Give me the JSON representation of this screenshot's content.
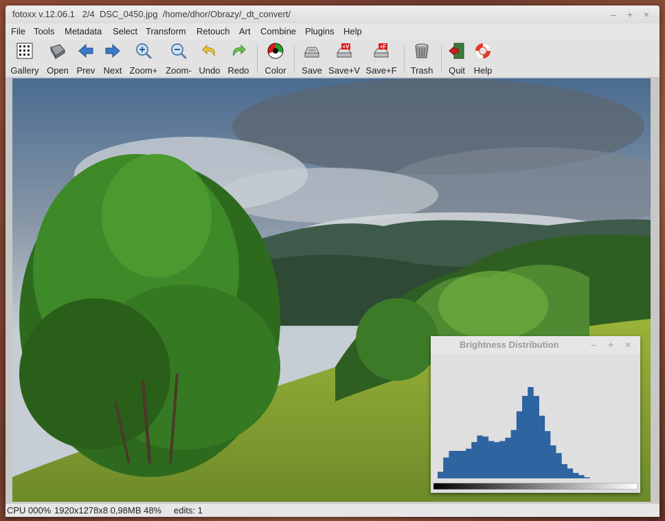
{
  "window": {
    "title": "fotoxx v.12.06.1   2/4  DSC_0450.jpg  /home/dhor/Obrazy/_dt_convert/",
    "controls": {
      "minimize": "–",
      "maximize": "+",
      "close": "×"
    }
  },
  "menu": [
    "File",
    "Tools",
    "Metadata",
    "Select",
    "Transform",
    "Retouch",
    "Art",
    "Combine",
    "Plugins",
    "Help"
  ],
  "toolbar": [
    {
      "label": "Gallery",
      "icon": "gallery-icon"
    },
    {
      "label": "Open",
      "icon": "open-icon"
    },
    {
      "label": "Prev",
      "icon": "prev-arrow-icon"
    },
    {
      "label": "Next",
      "icon": "next-arrow-icon"
    },
    {
      "label": "Zoom+",
      "icon": "zoom-in-icon"
    },
    {
      "label": "Zoom-",
      "icon": "zoom-out-icon"
    },
    {
      "label": "Undo",
      "icon": "undo-icon"
    },
    {
      "label": "Redo",
      "icon": "redo-icon"
    },
    {
      "label": "Color",
      "icon": "color-wheel-icon"
    },
    {
      "label": "Save",
      "icon": "save-icon"
    },
    {
      "label": "Save+V",
      "icon": "save-version-icon"
    },
    {
      "label": "Save+F",
      "icon": "save-file-icon"
    },
    {
      "label": "Trash",
      "icon": "trash-icon"
    },
    {
      "label": "Quit",
      "icon": "quit-icon"
    },
    {
      "label": "Help",
      "icon": "lifebuoy-icon"
    }
  ],
  "status": {
    "cpu": "CPU 000%",
    "info": "1920x1278x8 0,98MB 48%",
    "edits": "edits: 1"
  },
  "histogram_window": {
    "title": "Brightness Distribution",
    "controls": {
      "minimize": "–",
      "maximize": "+",
      "close": "×"
    }
  },
  "chart_data": {
    "type": "bar",
    "title": "Brightness Distribution",
    "bar_color": "#2e64a0",
    "values": [
      0.06,
      0.19,
      0.25,
      0.25,
      0.25,
      0.27,
      0.33,
      0.39,
      0.38,
      0.34,
      0.33,
      0.34,
      0.37,
      0.44,
      0.61,
      0.75,
      0.83,
      0.75,
      0.57,
      0.43,
      0.3,
      0.23,
      0.13,
      0.09,
      0.05,
      0.03,
      0.01
    ]
  },
  "colors": {
    "window_bg": "#dddddd",
    "histogram_bar": "#2e64a0"
  }
}
